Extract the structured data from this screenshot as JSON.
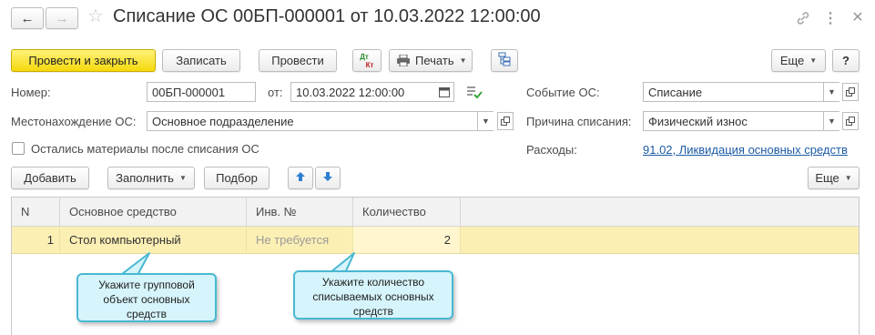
{
  "title": "Списание ОС 00БП-000001 от 10.03.2022 12:00:00",
  "nav": {
    "back_glyph": "←",
    "forward_glyph": "→"
  },
  "window_icons": {
    "link": "link-icon",
    "menu": "more-vertical-icon",
    "close": "close-icon"
  },
  "toolbar": {
    "post_close_label": "Провести и закрыть",
    "save_label": "Записать",
    "post_label": "Провести",
    "dtkt_top": "Дт",
    "dtkt_bottom": "Кт",
    "print_label": "Печать",
    "more_label": "Еще",
    "help_label": "?"
  },
  "form": {
    "number_label": "Номер:",
    "number_value": "00БП-000001",
    "date_label": "от:",
    "date_value": "10.03.2022 12:00:00",
    "event_label": "Событие ОС:",
    "event_value": "Списание",
    "location_label": "Местонахождение ОС:",
    "location_value": "Основное подразделение",
    "reason_label": "Причина списания:",
    "reason_value": "Физический износ",
    "materials_label": "Остались материалы после списания ОС",
    "materials_checked": false,
    "expenses_label": "Расходы:",
    "expenses_link": "91.02, Ликвидация основных средств"
  },
  "table_toolbar": {
    "add_label": "Добавить",
    "fill_label": "Заполнить",
    "select_label": "Подбор",
    "more_label": "Еще"
  },
  "table": {
    "columns": [
      "N",
      "Основное средство",
      "Инв. №",
      "Количество"
    ],
    "rows": [
      {
        "n": "1",
        "asset": "Стол компьютерный",
        "inv": "Не требуется",
        "qty": "2"
      }
    ]
  },
  "callouts": {
    "group_object": "Укажите групповой объект основных средств",
    "quantity": "Укажите количество списываемых основных средств"
  },
  "colors": {
    "primary": "#f5d90c",
    "link": "#1c5aa6",
    "row_selected": "#fbefb4",
    "callout_border": "#49b8d3"
  }
}
